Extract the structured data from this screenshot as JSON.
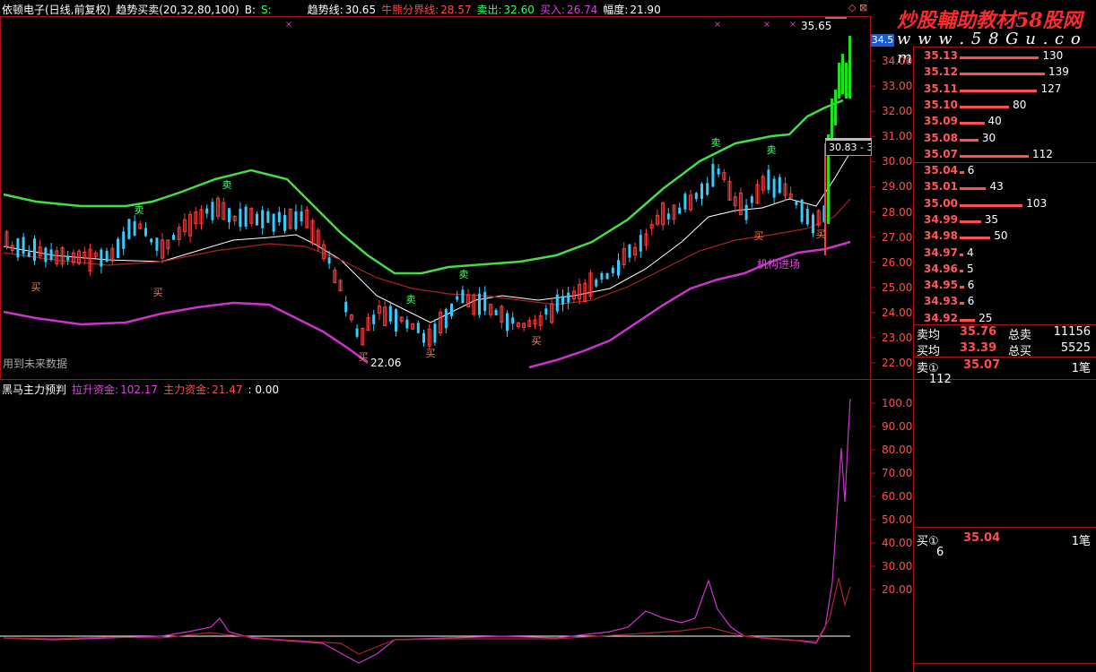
{
  "header": {
    "stock": "依顿电子(日线,前复权)",
    "indicator": "趋势买卖(20,32,80,100)",
    "b_label": "B:",
    "s_label": "S:",
    "trend_label": "趋势线:",
    "trend_value": "30.65",
    "bullbear_label": "牛熊分界线:",
    "bullbear_value": "28.57",
    "sell_label": "卖出:",
    "sell_value": "32.60",
    "buy_label": "买入:",
    "buy_value": "26.74",
    "amp_label": "幅度:",
    "amp_value": "21.90"
  },
  "watermark": {
    "title": "炒股輔助教材58股网",
    "url": "w w w . 5 8 G u . c o m"
  },
  "price_axis": {
    "ticks": [
      "34.00",
      "33.00",
      "32.00",
      "31.00",
      "30.00",
      "29.00",
      "28.00",
      "27.00",
      "26.00",
      "25.00",
      "24.00",
      "23.00",
      "22.00"
    ],
    "current_tag": "34.5"
  },
  "annotations": {
    "high_label": "35.65",
    "low_label": "22.06",
    "tooltip_label": "30.83 - 3",
    "inst_label": "机构进场",
    "future_label": "用到未来数据",
    "sell_marker": "卖",
    "buy_marker": "买"
  },
  "order_book": {
    "asks": [
      {
        "price": "35.13",
        "vol": "130",
        "bar": 0.93
      },
      {
        "price": "35.12",
        "vol": "139",
        "bar": 1.0
      },
      {
        "price": "35.11",
        "vol": "127",
        "bar": 0.91
      },
      {
        "price": "35.10",
        "vol": "80",
        "bar": 0.58
      },
      {
        "price": "35.09",
        "vol": "40",
        "bar": 0.29
      },
      {
        "price": "35.08",
        "vol": "30",
        "bar": 0.22
      },
      {
        "price": "35.07",
        "vol": "112",
        "bar": 0.81
      }
    ],
    "bids": [
      {
        "price": "35.04",
        "vol": "6",
        "bar": 0.05
      },
      {
        "price": "35.01",
        "vol": "43",
        "bar": 0.31
      },
      {
        "price": "35.00",
        "vol": "103",
        "bar": 0.74
      },
      {
        "price": "34.99",
        "vol": "35",
        "bar": 0.25
      },
      {
        "price": "34.98",
        "vol": "50",
        "bar": 0.36
      },
      {
        "price": "34.97",
        "vol": "4",
        "bar": 0.03
      },
      {
        "price": "34.96",
        "vol": "5",
        "bar": 0.04
      },
      {
        "price": "34.95",
        "vol": "6",
        "bar": 0.05
      },
      {
        "price": "34.93",
        "vol": "6",
        "bar": 0.05
      },
      {
        "price": "34.92",
        "vol": "25",
        "bar": 0.18
      }
    ],
    "sell_avg_label": "卖均",
    "sell_avg_value": "35.76",
    "total_sell_label": "总卖",
    "total_sell_value": "11156",
    "buy_avg_label": "买均",
    "buy_avg_value": "33.39",
    "total_buy_label": "总买",
    "total_buy_value": "5525",
    "sell1_label": "卖①",
    "sell1_price": "35.07",
    "sell1_unit": "1笔",
    "sell1_vol": "112",
    "buy1_label": "买①",
    "buy1_price": "35.04",
    "buy1_unit": "1笔",
    "buy1_vol": "6"
  },
  "lower_panel": {
    "title": "黑马主力预判",
    "lift_label": "拉升资金:",
    "lift_value": "102.17",
    "main_label": "主力资金:",
    "main_value": "21.47",
    "extra_value": ": 0.00",
    "ticks": [
      "100.0",
      "90.00",
      "80.00",
      "70.00",
      "60.00",
      "50.00",
      "40.00",
      "30.00",
      "20.00"
    ]
  },
  "colors": {
    "upper_band": "#44dd44",
    "lower_band": "#cc33cc",
    "ma_white": "#ffffff",
    "ma_red": "#aa2222",
    "candle_up": "#ff3b3b",
    "candle_down": "#33ccff",
    "grid_frame": "#aa1111"
  }
}
